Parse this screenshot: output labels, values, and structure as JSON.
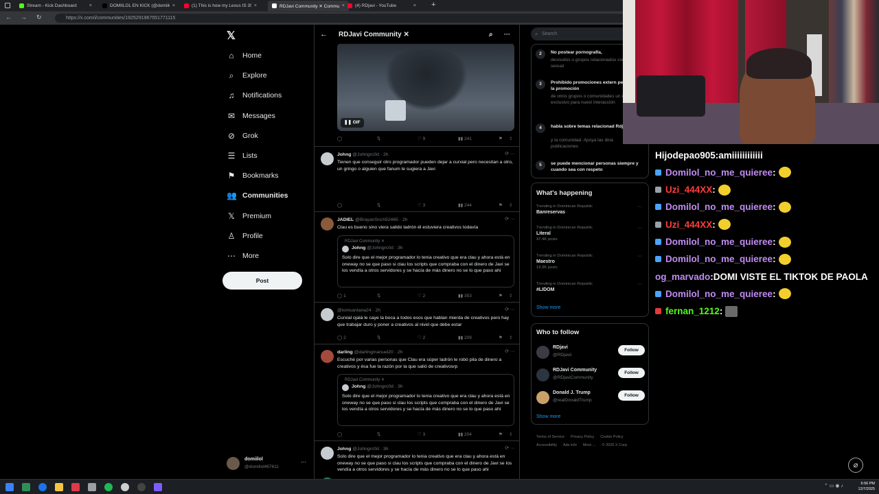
{
  "browser": {
    "tabs": [
      {
        "title": "Stream - Kick Dashboard",
        "color": "#53fc18"
      },
      {
        "title": "DOMIILOL EN KICK (@domiilol_c",
        "color": "#000000"
      },
      {
        "title": "(1) This is how my Lexus IS 350 lo",
        "color": "#ff0033"
      },
      {
        "title": "RDJavi Community ✕ Communit",
        "color": "#ffffff"
      },
      {
        "title": "(4) RDjavi - YouTube",
        "color": "#ff0033"
      }
    ],
    "url": "https://x.com/i/communities/1925291967551771115"
  },
  "nav": {
    "items": [
      {
        "label": "Home",
        "icon": "home-icon",
        "glyph": "⌂"
      },
      {
        "label": "Explore",
        "icon": "search-icon",
        "glyph": "⌕"
      },
      {
        "label": "Notifications",
        "icon": "bell-icon",
        "glyph": "♫"
      },
      {
        "label": "Messages",
        "icon": "mail-icon",
        "glyph": "✉"
      },
      {
        "label": "Grok",
        "icon": "grok-icon",
        "glyph": "⊘"
      },
      {
        "label": "Lists",
        "icon": "list-icon",
        "glyph": "☰"
      },
      {
        "label": "Bookmarks",
        "icon": "bookmark-icon",
        "glyph": "⚑"
      },
      {
        "label": "Communities",
        "icon": "communities-icon",
        "glyph": "👥"
      },
      {
        "label": "Premium",
        "icon": "x-logo-icon",
        "glyph": "𝕏"
      },
      {
        "label": "Profile",
        "icon": "person-icon",
        "glyph": "♙"
      },
      {
        "label": "More",
        "icon": "more-circle-icon",
        "glyph": "⋯"
      }
    ],
    "post_label": "Post",
    "account": {
      "name": "domiilol",
      "handle": "@domiilol467611"
    }
  },
  "feed": {
    "title": "RDJavi Community ✕",
    "gif_label": "GIF",
    "top_actions": {
      "likes": "9",
      "views": "241"
    },
    "tweets": [
      {
        "name": "Johng",
        "handle": "@Johngrc0d",
        "time": "2h",
        "text": "Tienen que conseguir otro programador pueden dejar a curxial pero necesitan a otro, un gringo o alguien que fanum le sugiera a Javi",
        "replies": "",
        "reposts": "",
        "likes": "3",
        "views": "244"
      },
      {
        "name": "JADIEL",
        "handle": "@BrayanSnch52465",
        "time": "2h",
        "text": "Clau es bueno sino viera salido ladrón él estuviera creativos todavía",
        "quote": {
          "community": "RDJavi Community ✕",
          "name": "Johng",
          "handle": "@Johngrc0d",
          "time": "3h",
          "text": "Solo dire que el mejor programador lo tenia creativo que era clau y ahora está en oneway no se que paso si clau los scripts que compraba con el dinero de Javi se los vendía a otros servidores y se hacía de más dinero no se lo que paso ahi"
        },
        "replies": "1",
        "reposts": "",
        "likes": "2",
        "views": "353"
      },
      {
        "name": "",
        "handle": "@tonisantana24",
        "time": "2h",
        "text": "Curxial ojalá le caye la boca a todos esos que hablan mierda de creativos pero hay que trabajar duro y poner a creativos al nivel que debe estar",
        "replies": "2",
        "reposts": "",
        "likes": "2",
        "views": "209"
      },
      {
        "name": "darling",
        "handle": "@darlingmanuel20",
        "time": "2h",
        "text": "Escuché por varias personas que Clau era súper ladrón le robó pila de dinero a creativos y ésa fue la razón por la que salió de creativosrp",
        "quote": {
          "community": "RDJavi Community ✕",
          "name": "Johng",
          "handle": "@Johngrc0d",
          "time": "3h",
          "text": "Solo dire que el mejor programador lo tenia creativo que era clau y ahora está en oneway no se que paso si clau los scripts que compraba con el dinero de Javi se los vendía a otros servidores y se hacía de más dinero no se lo que paso ahi"
        },
        "replies": "",
        "reposts": "",
        "likes": "3",
        "views": "204"
      },
      {
        "name": "Johng",
        "handle": "@Johngrc0d",
        "time": "3h",
        "text": "Solo dire que el mejor programador lo tenia creativo que era clau y ahora está en oneway no se que paso si clau los scripts que compraba con el dinero de Javi se los vendía a otros servidores y se hacía de más dinero no se lo que paso ahi",
        "replies": "1",
        "reposts": "2",
        "likes": "2",
        "views": "703"
      }
    ]
  },
  "right": {
    "search_placeholder": "Search",
    "rules": [
      {
        "n": "2",
        "title": "No postear pornografía,",
        "desc": "desnudos o grupos relacionados contenido sexual"
      },
      {
        "n": "3",
        "title": "Prohibido promociones extern permite la promoción",
        "desc": "de otros grupos o comunidades un espacio exclusivo para nuest interacción"
      },
      {
        "n": "4",
        "title": "habla sobre temas relacionad Rdjavi",
        "desc": "y la comunidad. Apoya las diná publicaciones"
      },
      {
        "n": "5",
        "title": "se puede mencionar personas siempre y cuando sea con respeto",
        "desc": ""
      }
    ],
    "whats_happening_title": "What's happening",
    "trends": [
      {
        "context": "Trending in Dominican Republic",
        "name": "Banreservas",
        "posts": ""
      },
      {
        "context": "Trending in Dominican Republic",
        "name": "Literal",
        "posts": "47.4K posts"
      },
      {
        "context": "Trending in Dominican Republic",
        "name": "Maestro",
        "posts": "19.3K posts"
      },
      {
        "context": "Trending in Dominican Republic",
        "name": "#LIDOM",
        "posts": ""
      }
    ],
    "show_more": "Show more",
    "who_to_follow_title": "Who to follow",
    "follows": [
      {
        "name": "RDjavi",
        "handle": "@RDjavii",
        "btn": "Follow",
        "color": "#3b3b46"
      },
      {
        "name": "RDJavi Community",
        "handle": "@RDjaviCommunity",
        "btn": "Follow",
        "color": "#2c3440"
      },
      {
        "name": "Donald J. Trump",
        "handle": "@realDonaldTrump",
        "btn": "Follow",
        "color": "#c9a06a"
      }
    ],
    "footer": [
      "Terms of Service",
      "Privacy Policy",
      "Cookie Policy",
      "Accessibility",
      "Ads info",
      "More ...",
      "© 2025 X Corp."
    ]
  },
  "chat": [
    {
      "user": "Hijodepao905",
      "msg": "amiiiiiiiiiiii",
      "color": "#ffffff",
      "badge": "",
      "emote": false
    },
    {
      "user": "Domilol_no_me_quieree",
      "msg": "",
      "color": "#c08cf2",
      "badge": "kick",
      "emote": true
    },
    {
      "user": "Uzi_444XX",
      "msg": "",
      "color": "#ff3c3c",
      "badge": "mod",
      "emote": true
    },
    {
      "user": "Domilol_no_me_quieree",
      "msg": "",
      "color": "#c08cf2",
      "badge": "kick",
      "emote": true
    },
    {
      "user": "Uzi_444XX",
      "msg": "",
      "color": "#ff3c3c",
      "badge": "mod",
      "emote": true
    },
    {
      "user": "Domilol_no_me_quieree",
      "msg": "",
      "color": "#c08cf2",
      "badge": "kick",
      "emote": true
    },
    {
      "user": "Domilol_no_me_quieree",
      "msg": "",
      "color": "#c08cf2",
      "badge": "kick",
      "emote": true
    },
    {
      "user": "og_marvado",
      "msg": "DOMI VISTE EL TIKTOK DE PAOLA",
      "color": "#c08cf2",
      "badge": "",
      "emote": false
    },
    {
      "user": "Domilol_no_me_quieree",
      "msg": "",
      "color": "#c08cf2",
      "badge": "kick",
      "emote": true
    },
    {
      "user": "fernan_1212",
      "msg": "",
      "color": "#53fc18",
      "badge": "sub",
      "emote": true
    }
  ],
  "taskbar": {
    "time": "6:56 PM",
    "date": "12/7/2025"
  }
}
